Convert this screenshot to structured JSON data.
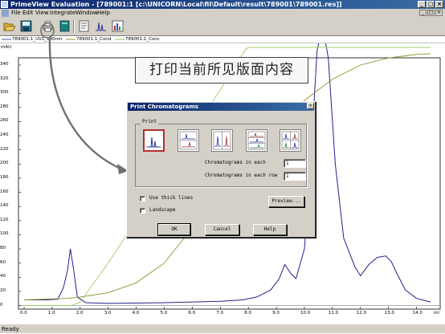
{
  "window": {
    "title": "PrimeView Evaluation - [789001:1     [c:\\UNICORN\\Local\\fil\\Default\\result\\789001\\789001.res]]",
    "buttons": [
      "_",
      "□",
      "×"
    ]
  },
  "menu": {
    "items": [
      "File",
      "Edit",
      "View",
      "Integrate",
      "Window",
      "Help"
    ]
  },
  "legend": {
    "items": [
      {
        "label": "789001:1_UV1_280nm",
        "color": "#4a5aa8"
      },
      {
        "label": "789001:1_Cond",
        "color": "#909030"
      },
      {
        "label": "789001:1_Conc",
        "color": "#90c060"
      }
    ]
  },
  "chart_data": {
    "type": "line",
    "ylabel": "mAU",
    "y_ticks": [
      "340",
      "320",
      "300",
      "280",
      "260",
      "240",
      "220",
      "200",
      "180",
      "160",
      "140",
      "120",
      "100",
      "80",
      "60",
      "40",
      "20",
      "0"
    ],
    "x_ticks": [
      "0.0",
      "1.0",
      "2.0",
      "3.0",
      "4.0",
      "5.0",
      "6.0",
      "7.0",
      "8.0",
      "9.0",
      "10.0",
      "11.0",
      "12.0",
      "13.0",
      "14.0"
    ],
    "xlabel": "ml",
    "series": [
      {
        "name": "789001:1_UV1_280nm",
        "color": "#22228a",
        "x": [
          0.0,
          0.8,
          1.2,
          1.4,
          1.55,
          1.65,
          1.75,
          1.9,
          2.2,
          3.0,
          5.0,
          7.0,
          7.8,
          8.3,
          8.8,
          9.1,
          9.3,
          9.5,
          9.7,
          10.0,
          10.2,
          10.45,
          10.65,
          10.85,
          11.1,
          11.4,
          11.8,
          12.0,
          12.3,
          12.6,
          12.9,
          13.1,
          13.3,
          13.6,
          14.0,
          14.5
        ],
        "y": [
          8,
          8,
          9,
          25,
          50,
          80,
          55,
          12,
          4,
          3,
          4,
          6,
          8,
          12,
          22,
          38,
          58,
          46,
          38,
          80,
          190,
          360,
          395,
          350,
          200,
          95,
          55,
          42,
          58,
          68,
          70,
          62,
          45,
          22,
          10,
          5
        ]
      },
      {
        "name": "789001:1_Cond",
        "color": "#909030",
        "x": [
          0.0,
          1.5,
          2.0,
          3.0,
          4.0,
          5.0,
          6.0,
          7.0,
          8.0,
          9.0,
          10.0,
          11.0,
          12.0,
          13.0,
          14.0,
          14.5
        ],
        "y": [
          8,
          10,
          12,
          18,
          32,
          60,
          110,
          165,
          210,
          250,
          290,
          320,
          340,
          350,
          355,
          356
        ]
      },
      {
        "name": "789001:1_Conc",
        "color": "#9ccc66",
        "x": [
          0.0,
          1.7,
          2.0,
          3.0,
          4.0,
          5.0,
          6.0,
          7.0,
          7.9,
          8.0,
          14.5
        ],
        "y": [
          0,
          0,
          5,
          60,
          120,
          180,
          245,
          305,
          362,
          365,
          365
        ]
      }
    ]
  },
  "callout": {
    "text": "打印当前所见版面内容"
  },
  "dialog": {
    "title": "Print Chromatograms",
    "close": "×",
    "group_label": "Print",
    "label_each": "Chromatograms in each",
    "value_each": "1",
    "label_row": "Chromatograms in each row",
    "value_row": "1",
    "thick_lines": "Use thick lines",
    "landscape": "Landscape",
    "preview": "Preview...",
    "ok": "OK",
    "cancel": "Cancel",
    "help": "Help"
  },
  "status": {
    "text": "Ready"
  }
}
